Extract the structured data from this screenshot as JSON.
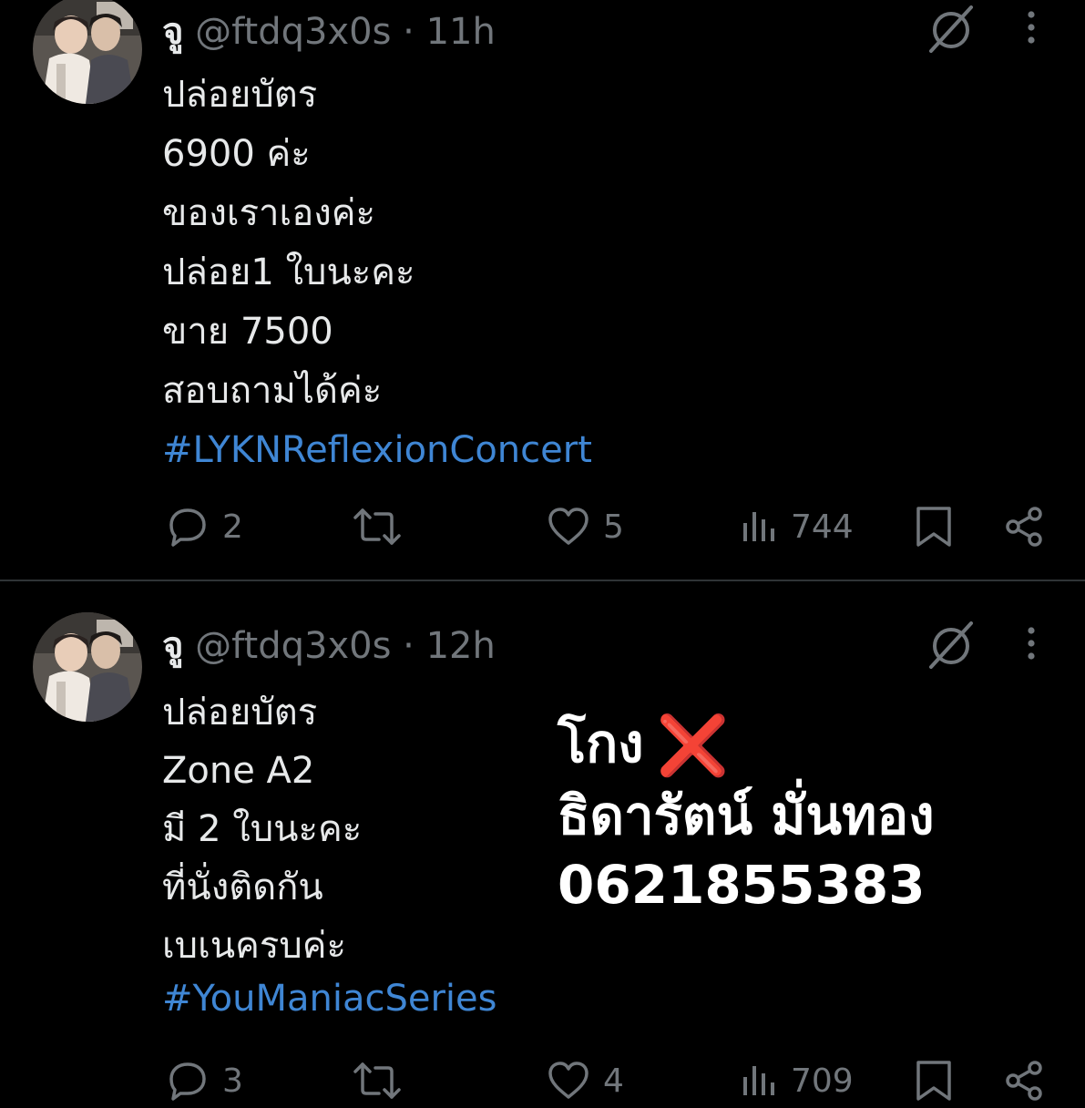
{
  "tweets": [
    {
      "display_name": "จู",
      "handle": "@ftdq3x0s",
      "separator": "·",
      "time": "11h",
      "lines": [
        "ปล่อยบัตร",
        "6900 ค่ะ",
        "ของเราเองค่ะ",
        "ปล่อย1 ใบนะคะ",
        "ขาย 7500",
        "สอบถามได้ค่ะ"
      ],
      "hashtag": "#LYKNReflexionConcert",
      "replies": "2",
      "retweets": "",
      "likes": "5",
      "views": "744"
    },
    {
      "display_name": "จู",
      "handle": "@ftdq3x0s",
      "separator": "·",
      "time": "12h",
      "lines": [
        "ปล่อยบัตร",
        "Zone A2",
        "มี 2 ใบนะคะ",
        "ที่นั่งติดกัน",
        "เบเนครบค่ะ"
      ],
      "hashtag": "#YouManiacSeries",
      "replies": "3",
      "retweets": "",
      "likes": "4",
      "views": "709"
    }
  ],
  "overlay": {
    "line1": "โกง",
    "mark": "❌",
    "line2": "ธิดารัตน์ มั่นทอง",
    "line3": "0621855383"
  },
  "colors": {
    "background": "#000000",
    "text": "#e7e9ea",
    "muted": "#71767b",
    "hashtag": "#3f86d4",
    "divider": "#2f3336",
    "warning": "#e0312f"
  },
  "icons": [
    "grok-icon",
    "more-icon",
    "reply-icon",
    "retweet-icon",
    "like-icon",
    "views-icon",
    "bookmark-icon",
    "share-icon"
  ]
}
